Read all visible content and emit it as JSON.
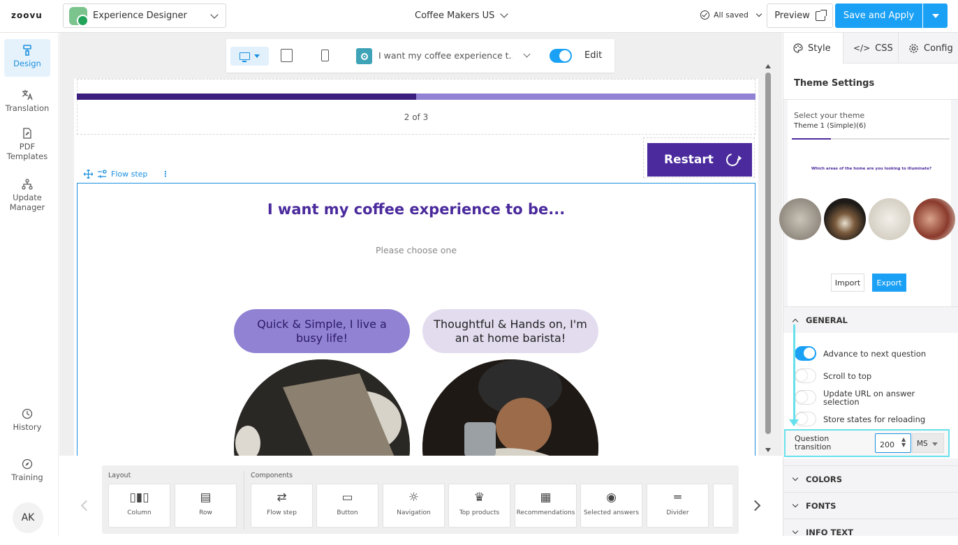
{
  "topbar": {
    "logo": "zoovu",
    "app_name": "Experience Designer",
    "project_name": "Coffee Makers US",
    "saved_status": "All saved",
    "preview_label": "Preview",
    "save_apply_label": "Save and Apply"
  },
  "nav": {
    "items": [
      {
        "label": "Design",
        "icon": "paint-roller-icon",
        "active": true
      },
      {
        "label": "Translation",
        "icon": "translate-icon"
      },
      {
        "label": "PDF Templates",
        "icon": "pdf-icon"
      },
      {
        "label": "Update Manager",
        "icon": "tree-icon"
      },
      {
        "label": "History",
        "icon": "history-icon"
      },
      {
        "label": "Training",
        "icon": "compass-icon"
      }
    ],
    "avatar_initials": "AK"
  },
  "device_bar": {
    "question_select": "I want my coffee experience t...",
    "edit_label": "Edit",
    "edit_on": true
  },
  "preview": {
    "progress": 0.5,
    "step_text": "2 of 3",
    "restart_label": "Restart",
    "flow_step_label": "Flow step",
    "question_title": "I want my coffee experience to be...",
    "question_subtitle": "Please choose one",
    "answers": [
      {
        "label": "Quick & Simple, I live a busy life!"
      },
      {
        "label": "Thoughtful & Hands on, I'm an at home barista!"
      }
    ]
  },
  "library": {
    "layout_label": "Layout",
    "components_label": "Components",
    "items": [
      {
        "label": "Column",
        "icon": "column-icon"
      },
      {
        "label": "Row",
        "icon": "row-icon"
      },
      {
        "label": "Flow step",
        "icon": "flow-step-icon"
      },
      {
        "label": "Button",
        "icon": "button-icon"
      },
      {
        "label": "Navigation",
        "icon": "navigation-icon"
      },
      {
        "label": "Top products",
        "icon": "top-products-icon"
      },
      {
        "label": "Recommendations",
        "icon": "recommendations-icon"
      },
      {
        "label": "Selected answers",
        "icon": "tag-icon"
      },
      {
        "label": "Divider",
        "icon": "divider-icon"
      }
    ]
  },
  "right_panel": {
    "tabs": [
      "Style",
      "CSS",
      "Config"
    ],
    "theme_title": "Theme Settings",
    "select_theme_label": "Select your theme",
    "theme_value": "Theme 1 (Simple)(6)",
    "theme_preview_question": "Which areas of the home are you looking to illuminate?",
    "import_label": "Import",
    "export_label": "Export",
    "general_label": "GENERAL",
    "options": [
      {
        "label": "Advance to next question",
        "on": true
      },
      {
        "label": "Scroll to top",
        "on": false
      },
      {
        "label": "Update URL on answer selection",
        "on": false
      },
      {
        "label": "Store states for reloading",
        "on": false
      }
    ],
    "question_transition_label": "Question transition",
    "question_transition_value": "200",
    "question_transition_unit": "MS",
    "colors_label": "COLORS",
    "fonts_label": "FONTS",
    "info_text_label": "INFO TEXT"
  },
  "colors": {
    "accent": "#1aa0f5",
    "brand_purple": "#4a2a9c",
    "highlight": "#66e0ec"
  }
}
